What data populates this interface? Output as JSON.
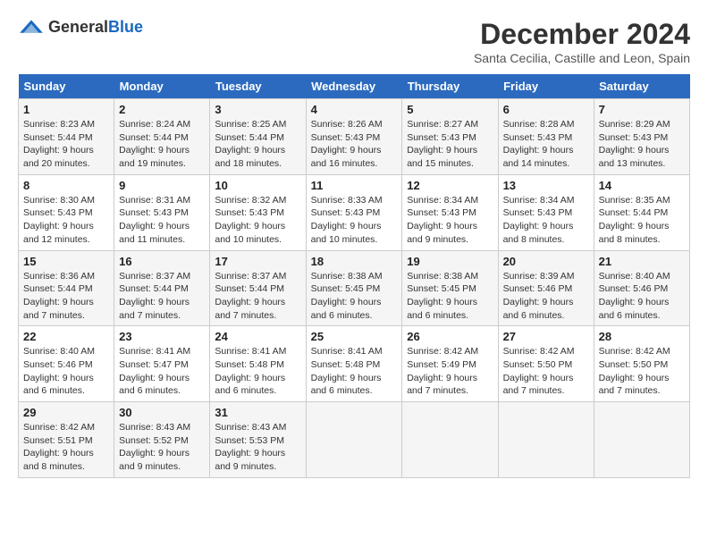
{
  "logo": {
    "general": "General",
    "blue": "Blue"
  },
  "title": "December 2024",
  "location": "Santa Cecilia, Castille and Leon, Spain",
  "days_of_week": [
    "Sunday",
    "Monday",
    "Tuesday",
    "Wednesday",
    "Thursday",
    "Friday",
    "Saturday"
  ],
  "weeks": [
    [
      {
        "day": "1",
        "sunrise": "8:23 AM",
        "sunset": "5:44 PM",
        "daylight": "9 hours and 20 minutes."
      },
      {
        "day": "2",
        "sunrise": "8:24 AM",
        "sunset": "5:44 PM",
        "daylight": "9 hours and 19 minutes."
      },
      {
        "day": "3",
        "sunrise": "8:25 AM",
        "sunset": "5:44 PM",
        "daylight": "9 hours and 18 minutes."
      },
      {
        "day": "4",
        "sunrise": "8:26 AM",
        "sunset": "5:43 PM",
        "daylight": "9 hours and 16 minutes."
      },
      {
        "day": "5",
        "sunrise": "8:27 AM",
        "sunset": "5:43 PM",
        "daylight": "9 hours and 15 minutes."
      },
      {
        "day": "6",
        "sunrise": "8:28 AM",
        "sunset": "5:43 PM",
        "daylight": "9 hours and 14 minutes."
      },
      {
        "day": "7",
        "sunrise": "8:29 AM",
        "sunset": "5:43 PM",
        "daylight": "9 hours and 13 minutes."
      }
    ],
    [
      {
        "day": "8",
        "sunrise": "8:30 AM",
        "sunset": "5:43 PM",
        "daylight": "9 hours and 12 minutes."
      },
      {
        "day": "9",
        "sunrise": "8:31 AM",
        "sunset": "5:43 PM",
        "daylight": "9 hours and 11 minutes."
      },
      {
        "day": "10",
        "sunrise": "8:32 AM",
        "sunset": "5:43 PM",
        "daylight": "9 hours and 10 minutes."
      },
      {
        "day": "11",
        "sunrise": "8:33 AM",
        "sunset": "5:43 PM",
        "daylight": "9 hours and 10 minutes."
      },
      {
        "day": "12",
        "sunrise": "8:34 AM",
        "sunset": "5:43 PM",
        "daylight": "9 hours and 9 minutes."
      },
      {
        "day": "13",
        "sunrise": "8:34 AM",
        "sunset": "5:43 PM",
        "daylight": "9 hours and 8 minutes."
      },
      {
        "day": "14",
        "sunrise": "8:35 AM",
        "sunset": "5:44 PM",
        "daylight": "9 hours and 8 minutes."
      }
    ],
    [
      {
        "day": "15",
        "sunrise": "8:36 AM",
        "sunset": "5:44 PM",
        "daylight": "9 hours and 7 minutes."
      },
      {
        "day": "16",
        "sunrise": "8:37 AM",
        "sunset": "5:44 PM",
        "daylight": "9 hours and 7 minutes."
      },
      {
        "day": "17",
        "sunrise": "8:37 AM",
        "sunset": "5:44 PM",
        "daylight": "9 hours and 7 minutes."
      },
      {
        "day": "18",
        "sunrise": "8:38 AM",
        "sunset": "5:45 PM",
        "daylight": "9 hours and 6 minutes."
      },
      {
        "day": "19",
        "sunrise": "8:38 AM",
        "sunset": "5:45 PM",
        "daylight": "9 hours and 6 minutes."
      },
      {
        "day": "20",
        "sunrise": "8:39 AM",
        "sunset": "5:46 PM",
        "daylight": "9 hours and 6 minutes."
      },
      {
        "day": "21",
        "sunrise": "8:40 AM",
        "sunset": "5:46 PM",
        "daylight": "9 hours and 6 minutes."
      }
    ],
    [
      {
        "day": "22",
        "sunrise": "8:40 AM",
        "sunset": "5:46 PM",
        "daylight": "9 hours and 6 minutes."
      },
      {
        "day": "23",
        "sunrise": "8:41 AM",
        "sunset": "5:47 PM",
        "daylight": "9 hours and 6 minutes."
      },
      {
        "day": "24",
        "sunrise": "8:41 AM",
        "sunset": "5:48 PM",
        "daylight": "9 hours and 6 minutes."
      },
      {
        "day": "25",
        "sunrise": "8:41 AM",
        "sunset": "5:48 PM",
        "daylight": "9 hours and 6 minutes."
      },
      {
        "day": "26",
        "sunrise": "8:42 AM",
        "sunset": "5:49 PM",
        "daylight": "9 hours and 7 minutes."
      },
      {
        "day": "27",
        "sunrise": "8:42 AM",
        "sunset": "5:50 PM",
        "daylight": "9 hours and 7 minutes."
      },
      {
        "day": "28",
        "sunrise": "8:42 AM",
        "sunset": "5:50 PM",
        "daylight": "9 hours and 7 minutes."
      }
    ],
    [
      {
        "day": "29",
        "sunrise": "8:42 AM",
        "sunset": "5:51 PM",
        "daylight": "9 hours and 8 minutes."
      },
      {
        "day": "30",
        "sunrise": "8:43 AM",
        "sunset": "5:52 PM",
        "daylight": "9 hours and 9 minutes."
      },
      {
        "day": "31",
        "sunrise": "8:43 AM",
        "sunset": "5:53 PM",
        "daylight": "9 hours and 9 minutes."
      },
      null,
      null,
      null,
      null
    ]
  ]
}
